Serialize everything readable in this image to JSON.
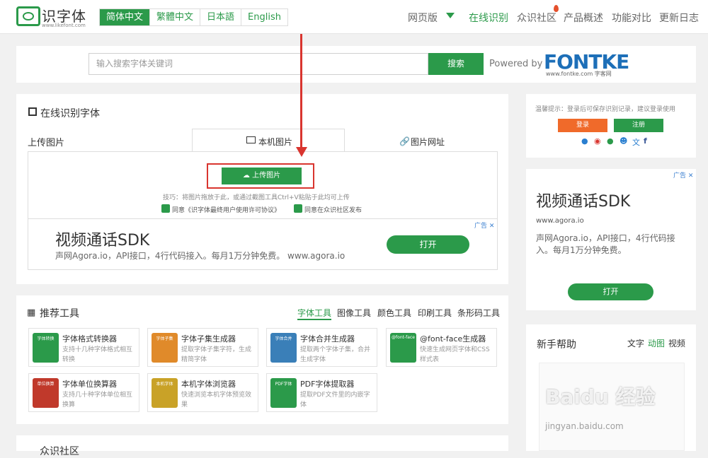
{
  "header": {
    "logo_text": "识字体",
    "logo_sub": "www.likefont.com",
    "langs": [
      "简体中文",
      "繁體中文",
      "日本語",
      "English"
    ],
    "nav": [
      "网页版",
      "在线识别",
      "众识社区",
      "产品概述",
      "功能对比",
      "更新日志"
    ]
  },
  "search": {
    "placeholder": "输入搜索字体关键词",
    "button": "搜索",
    "powered": "Powered by",
    "brand": "FONTKE",
    "brand_sub": "www.fontke.com 字客网"
  },
  "recognize": {
    "title": "在线识别字体",
    "tab_upload": "上传图片",
    "tab_local": "本机图片",
    "tab_url": "图片网址",
    "upload_button": "上传图片",
    "tip": "技巧：将图片拖放于此，或通过截图工具Ctrl+V粘贴于此均可上传",
    "agree1": "同意《识字体最终用户使用许可协议》",
    "agree2": "同意在众识社区发布"
  },
  "ad_main": {
    "title": "视频通话SDK",
    "sub": "声网Agora.io，API接口，4行代码接入。每月1万分钟免费。 www.agora.io",
    "button": "打开",
    "tag": "广告"
  },
  "login": {
    "hint": "温馨提示：登录后可保存识别记录，建议登录使用",
    "login": "登录",
    "register": "注册",
    "login_color": "#f06a2a",
    "register_color": "#2b9a4a"
  },
  "side_ad": {
    "title": "视频通话SDK",
    "url": "www.agora.io",
    "desc": "声网Agora.io，API接口，4行代码接入。每月1万分钟免费。",
    "button": "打开",
    "tag": "广告"
  },
  "tools": {
    "title": "推荐工具",
    "tabs": [
      "字体工具",
      "图像工具",
      "颜色工具",
      "印刷工具",
      "条形码工具"
    ],
    "items": [
      {
        "name": "字体格式转换器",
        "desc": "支持十几种字体格式相互转换",
        "color": "#2b9a4a",
        "icon_label": "字体转换"
      },
      {
        "name": "字体子集生成器",
        "desc": "提取字体子集字符，生成精简字体",
        "color": "#e08a2a",
        "icon_label": "字体子集"
      },
      {
        "name": "字体合并生成器",
        "desc": "提取两个字体子集，合并生成字体",
        "color": "#3a7fb8",
        "icon_label": "字体合并"
      },
      {
        "name": "@font-face生成器",
        "desc": "快速生成网页字体和CSS样式表",
        "color": "#2b9a4a",
        "icon_label": "@font-face"
      },
      {
        "name": "字体单位换算器",
        "desc": "支持几十种字体单位相互换算",
        "color": "#c0392b",
        "icon_label": "单位换算"
      },
      {
        "name": "本机字体浏览器",
        "desc": "快速浏览本机字体预览效果",
        "color": "#c9a227",
        "icon_label": "本机字体"
      },
      {
        "name": "PDF字体提取器",
        "desc": "提取PDF文件里的内嵌字体",
        "color": "#2b9a4a",
        "icon_label": "PDF字体"
      }
    ]
  },
  "help": {
    "title": "新手帮助",
    "tabs": [
      "文字",
      "动图",
      "视频"
    ]
  },
  "community": {
    "title": "众识社区"
  },
  "watermark": {
    "text": "Baidu 经验",
    "url": "jingyan.baidu.com"
  }
}
